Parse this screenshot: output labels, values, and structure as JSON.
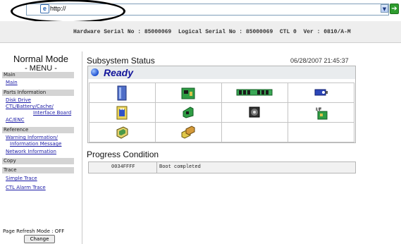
{
  "address_bar": {
    "url": "http://"
  },
  "header": {
    "hw_line": "Hardware Serial No : 85000069  Logical Serial No : 85000069  CTL 0  Ver : 0810/A-M"
  },
  "sidebar": {
    "mode_title": "Normal Mode",
    "menu_title": "- MENU -",
    "sections": [
      "Main",
      "Parts Information",
      "Reference",
      "Copy",
      "Trace"
    ],
    "links": {
      "main": "Main",
      "disk_drive": "Disk Drive",
      "ctl_battery_cache": "CTL/Battery/Cache/",
      "interface_board": "Interface Board",
      "ac_enc": "AC/ENC",
      "warning_info": "Warning Information/",
      "information_message": "Information Message",
      "network_info": "Network Information",
      "simple_trace": "Simple Trace",
      "ctl_alarm_trace": "CTL Alarm Trace"
    },
    "refresh_mode": "Page Refresh Mode : OFF",
    "change_button": "Change"
  },
  "subsystem": {
    "title": "Subsystem Status",
    "datetime": "06/28/2007 21:45:37",
    "status": "Ready",
    "status_color": "#12159a",
    "icons": [
      "disk-drive-icon",
      "controller-board-icon",
      "cache-memory-icon",
      "battery-icon",
      "ac-power-icon",
      "interface-board-icon",
      "fan-icon",
      "io-module-icon",
      "enclosure-icon",
      "loop-module-icon"
    ]
  },
  "progress": {
    "title": "Progress Condition",
    "code": "0034FFFF",
    "message": "Boot completed"
  }
}
